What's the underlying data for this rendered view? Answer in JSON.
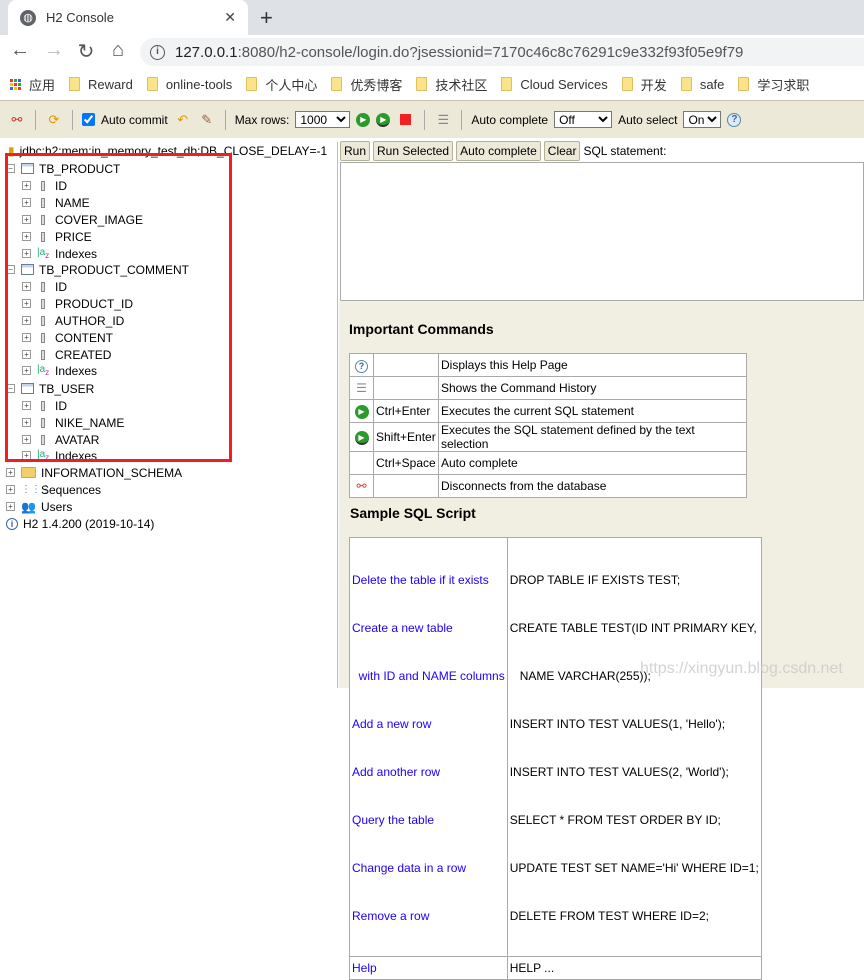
{
  "browser": {
    "tab_title": "H2 Console",
    "url_host": "127.0.0.1",
    "url_rest": ":8080/h2-console/login.do?jsessionid=7170c46c8c76291c9e332f93f05e9f79",
    "bookmarks": [
      "应用",
      "Reward",
      "online-tools",
      "个人中心",
      "优秀博客",
      "技术社区",
      "Cloud Services",
      "开发",
      "safe",
      "学习求职"
    ]
  },
  "toolbar": {
    "auto_commit": "Auto commit",
    "auto_commit_checked": true,
    "max_rows_label": "Max rows:",
    "max_rows": "1000",
    "auto_complete_label": "Auto complete",
    "auto_complete": "Off",
    "auto_select_label": "Auto select",
    "auto_select": "On"
  },
  "tree": {
    "connection": "jdbc:h2:mem:in_memory_test_db;DB_CLOSE_DELAY=-1",
    "tables": [
      {
        "name": "TB_PRODUCT",
        "columns": [
          "ID",
          "NAME",
          "COVER_IMAGE",
          "PRICE"
        ]
      },
      {
        "name": "TB_PRODUCT_COMMENT",
        "columns": [
          "ID",
          "PRODUCT_ID",
          "AUTHOR_ID",
          "CONTENT",
          "CREATED"
        ]
      },
      {
        "name": "TB_USER",
        "columns": [
          "ID",
          "NIKE_NAME",
          "AVATAR"
        ]
      }
    ],
    "indexes": "Indexes",
    "schema": "INFORMATION_SCHEMA",
    "sequences": "Sequences",
    "users": "Users",
    "version": "H2 1.4.200 (2019-10-14)"
  },
  "editor": {
    "run": "Run",
    "run_selected": "Run Selected",
    "auto_complete": "Auto complete",
    "clear": "Clear",
    "label": "SQL statement:",
    "value": ""
  },
  "help": {
    "important_title": "Important Commands",
    "commands": [
      {
        "icon": "help-icon",
        "key": "",
        "desc": "Displays this Help Page"
      },
      {
        "icon": "history-icon",
        "key": "",
        "desc": "Shows the Command History"
      },
      {
        "icon": "run-icon",
        "key": "Ctrl+Enter",
        "desc": "Executes the current SQL statement"
      },
      {
        "icon": "run-selected-icon",
        "key": "Shift+Enter",
        "desc": "Executes the SQL statement defined by the text selection"
      },
      {
        "icon": "",
        "key": "Ctrl+Space",
        "desc": "Auto complete"
      },
      {
        "icon": "disconnect-icon",
        "key": "",
        "desc": "Disconnects from the database"
      }
    ],
    "sample_title": "Sample SQL Script",
    "sample": [
      {
        "label": "Delete the table if it exists",
        "sql": "DROP TABLE IF EXISTS TEST;"
      },
      {
        "label": "Create a new table",
        "sql": "CREATE TABLE TEST(ID INT PRIMARY KEY,"
      },
      {
        "label": "  with ID and NAME columns",
        "sql": "   NAME VARCHAR(255));"
      },
      {
        "label": "Add a new row",
        "sql": "INSERT INTO TEST VALUES(1, 'Hello');"
      },
      {
        "label": "Add another row",
        "sql": "INSERT INTO TEST VALUES(2, 'World');"
      },
      {
        "label": "Query the table",
        "sql": "SELECT * FROM TEST ORDER BY ID;"
      },
      {
        "label": "Change data in a row",
        "sql": "UPDATE TEST SET NAME='Hi' WHERE ID=1;"
      },
      {
        "label": "Remove a row",
        "sql": "DELETE FROM TEST WHERE ID=2;"
      }
    ],
    "help_label": "Help",
    "help_sql": "HELP ..."
  },
  "watermark": "https://xingyun.blog.csdn.net"
}
